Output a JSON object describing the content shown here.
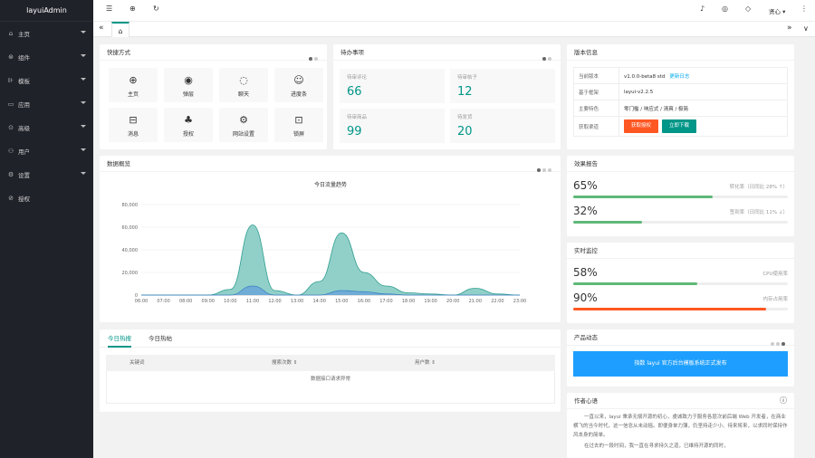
{
  "app": {
    "title": "layuiAdmin"
  },
  "sidebar": {
    "items": [
      {
        "label": "主页",
        "icon": "home-icon",
        "glyph": "⌂",
        "arrow": true
      },
      {
        "label": "组件",
        "icon": "component-icon",
        "glyph": "⊛",
        "arrow": true
      },
      {
        "label": "模板",
        "icon": "template-icon",
        "glyph": "⊪",
        "arrow": true
      },
      {
        "label": "应用",
        "icon": "app-icon",
        "glyph": "▭",
        "arrow": true
      },
      {
        "label": "高级",
        "icon": "senior-icon",
        "glyph": "⊙",
        "arrow": true
      },
      {
        "label": "用户",
        "icon": "user-icon",
        "glyph": "⚇",
        "arrow": true
      },
      {
        "label": "设置",
        "icon": "settings-icon",
        "glyph": "⚙",
        "arrow": true
      },
      {
        "label": "授权",
        "icon": "auth-icon",
        "glyph": "⊘",
        "arrow": false
      }
    ]
  },
  "header": {
    "user_label": "贤心",
    "glyphs": {
      "menu": "☰",
      "site": "⊕",
      "refresh": "↻",
      "bell": "♪",
      "theme": "◎",
      "note": "◇",
      "more": "⋮",
      "chevron": "▾"
    }
  },
  "tabs": {
    "home_glyph": "⌂",
    "prev": "«",
    "next": "»",
    "down": "∨"
  },
  "quick": {
    "title": "快捷方式",
    "items": [
      {
        "label": "主页",
        "icon": "globe-icon",
        "glyph": "⊕"
      },
      {
        "label": "弹层",
        "icon": "compass-icon",
        "glyph": "◉"
      },
      {
        "label": "聊天",
        "icon": "loading-icon",
        "glyph": "◌"
      },
      {
        "label": "进度条",
        "icon": "smile-icon",
        "glyph": "☺"
      },
      {
        "label": "消息",
        "icon": "book-icon",
        "glyph": "⊟"
      },
      {
        "label": "授权",
        "icon": "palm-icon",
        "glyph": "♣"
      },
      {
        "label": "网站设置",
        "icon": "gear-icon",
        "glyph": "⚙"
      },
      {
        "label": "锁屏",
        "icon": "lock-icon",
        "glyph": "⊡"
      }
    ]
  },
  "todo": {
    "title": "待办事项",
    "boxes": [
      {
        "label": "待审评论",
        "value": "66"
      },
      {
        "label": "待审帖子",
        "value": "12"
      },
      {
        "label": "待审商品",
        "value": "99"
      },
      {
        "label": "待发货",
        "value": "20"
      }
    ]
  },
  "version": {
    "title": "版本信息",
    "rows": [
      {
        "key": "当前版本",
        "value": "v1.0.0-beta8 std",
        "link": "更新日志"
      },
      {
        "key": "基于框架",
        "value": "layui-v2.2.5"
      },
      {
        "key": "主要特色",
        "value": "零门槛 / 响应式 / 清爽 / 极简"
      }
    ],
    "get_key": "获取渠道",
    "buy_label": "获取授权",
    "download_label": "立即下载"
  },
  "overview": {
    "title": "数据概览"
  },
  "chart_data": {
    "type": "area",
    "title": "今日流量趋势",
    "x": [
      "06:00",
      "07:00",
      "08:00",
      "09:00",
      "10:00",
      "11:00",
      "12:00",
      "13:00",
      "14:00",
      "15:00",
      "16:00",
      "17:00",
      "18:00",
      "19:00",
      "20:00",
      "21:00",
      "22:00",
      "23:00"
    ],
    "yticks": [
      "0",
      "20,000",
      "40,000",
      "60,000",
      "80,000"
    ],
    "ylim": [
      0,
      80000
    ],
    "series": [
      {
        "color": "#7ec8bf",
        "values": [
          0,
          0,
          0,
          0,
          5000,
          62000,
          4000,
          0,
          12000,
          55000,
          20000,
          8000,
          2000,
          1000,
          0,
          6000,
          1000,
          0
        ]
      },
      {
        "color": "#6aa7d8",
        "values": [
          0,
          0,
          0,
          0,
          0,
          8000,
          0,
          0,
          0,
          4000,
          3000,
          1000,
          0,
          0,
          0,
          0,
          0,
          0
        ]
      }
    ],
    "grid": true
  },
  "hot": {
    "tabs": [
      "今日热搜",
      "今日热帖"
    ],
    "columns": [
      "关键词",
      "搜索次数",
      "用户数"
    ],
    "empty": "数据接口请求异常"
  },
  "effect": {
    "title": "效果报告",
    "rows": [
      {
        "value": "65%",
        "label": "转化率（日同比 28% ↑）",
        "pct": 65,
        "color": "#5fb878"
      },
      {
        "value": "32%",
        "label": "签到率（日同比 11% ↓）",
        "pct": 32,
        "color": "#5fb878"
      }
    ]
  },
  "monitor": {
    "title": "实时监控",
    "rows": [
      {
        "value": "58%",
        "label": "CPU使用率",
        "pct": 58,
        "color": "#5fb878"
      },
      {
        "value": "90%",
        "label": "内存占用率",
        "pct": 90,
        "color": "#ff5722"
      }
    ]
  },
  "product": {
    "title": "产品动态",
    "banner": "指数 layui 官方后台模板系统正式发布"
  },
  "author": {
    "title": "作者心语",
    "text": "一直以来，layui 秉承无偿开源的初心，虔诚致力于服务各层次前后端 Web 开发者，在商业横飞的当今时代，这一信念从未动摇。即便身单力薄，仍坚持走少小、待来将来，以求同时保持作风本身的简单。",
    "text2": "在过去的一段时间，我一直在寻求持久之道，已维持开源的同时，"
  },
  "colors": {
    "accent": "#009688",
    "sidebar": "#20222a",
    "danger": "#ff5722",
    "blue": "#1e9fff"
  }
}
